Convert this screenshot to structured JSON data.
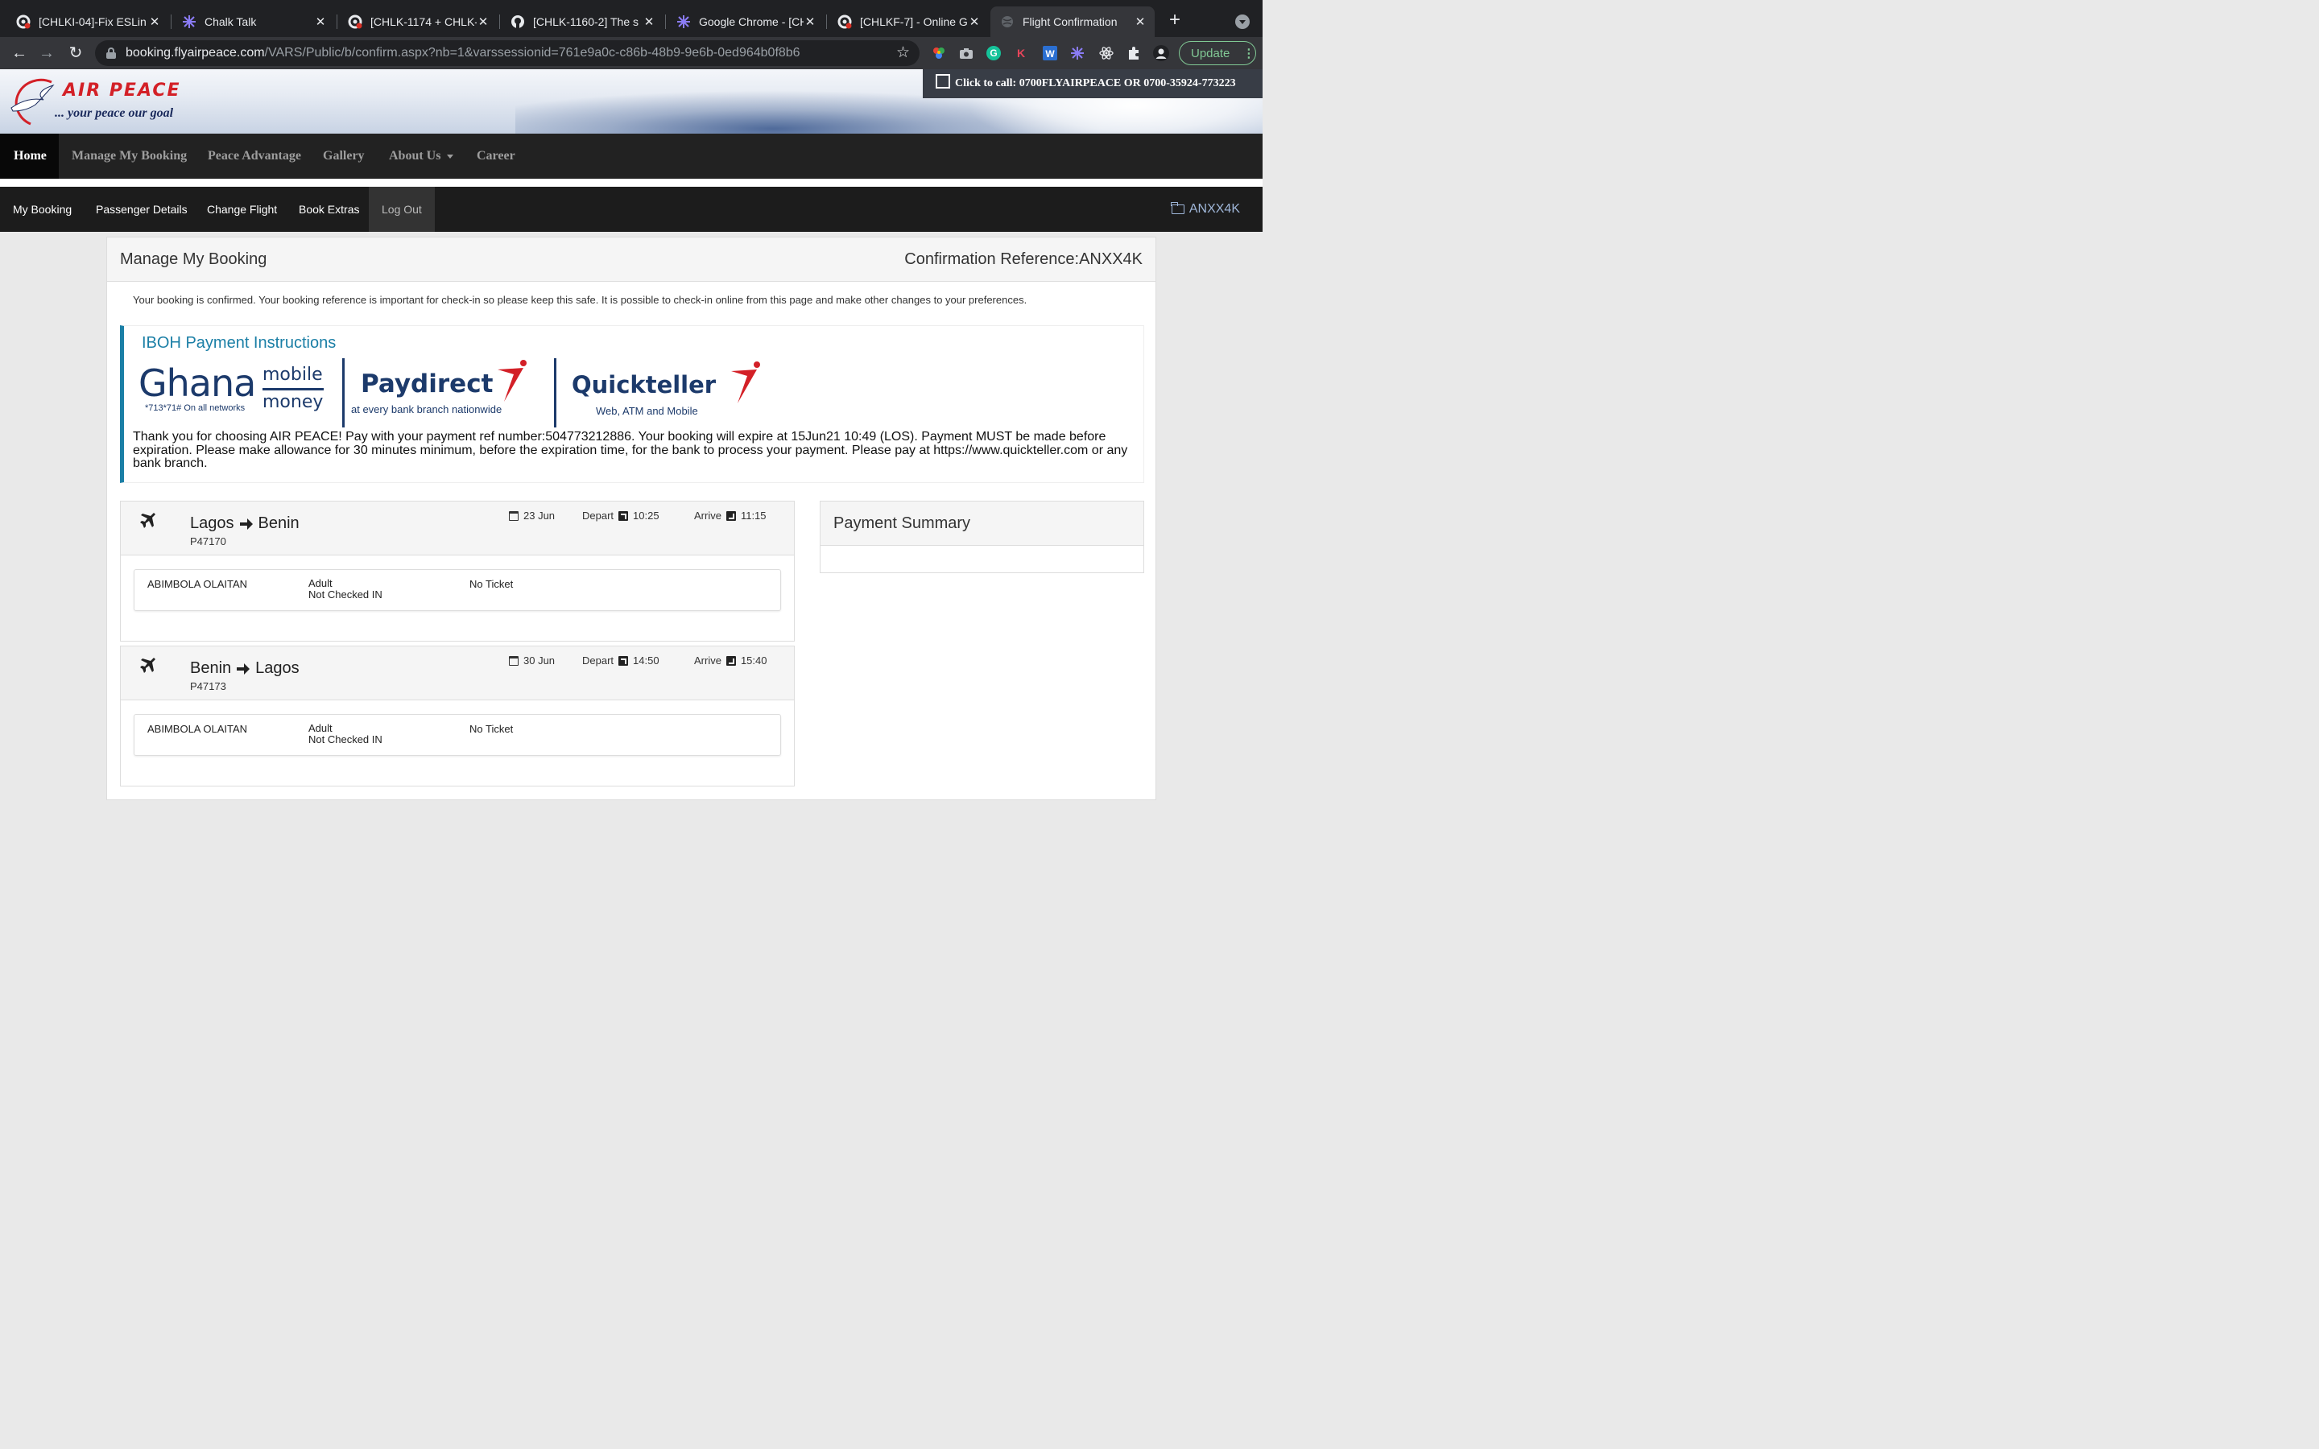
{
  "browser": {
    "tabs": [
      {
        "title": "[CHLKI-04]-Fix ESLin",
        "icon": "circleci-icon"
      },
      {
        "title": "Chalk Talk",
        "icon": "chalk-talk-icon"
      },
      {
        "title": "[CHLK-1174 + CHLK-",
        "icon": "circleci-icon"
      },
      {
        "title": "[CHLK-1160-2] The s",
        "icon": "github-icon"
      },
      {
        "title": "Google Chrome - [CH",
        "icon": "chalk-talk-icon"
      },
      {
        "title": "[CHLKF-7] - Online G",
        "icon": "circleci-icon"
      },
      {
        "title": "Flight Confirmation",
        "icon": "globe-icon"
      }
    ],
    "url_host": "booking.flyairpeace.com",
    "url_path": "/VARS/Public/b/confirm.aspx?nb=1&varssessionid=761e9a0c-c86b-48b9-9e6b-0ed964b0f8b6",
    "update_label": "Update"
  },
  "site": {
    "logo_name": "AIR PEACE",
    "tagline": "... your peace our goal",
    "call_text": "Click to call: 0700FLYAIRPEACE OR 0700-35924-773223",
    "main_nav": [
      "Home",
      "Manage My Booking",
      "Peace Advantage",
      "Gallery",
      "About Us",
      "Career"
    ],
    "sub_nav": [
      "My Booking",
      "Passenger Details",
      "Change Flight",
      "Book Extras",
      "Log Out"
    ],
    "booking_code": "ANXX4K"
  },
  "booking": {
    "title": "Manage My Booking",
    "confirmation_ref": "Confirmation Reference:ANXX4K",
    "notice": "Your booking is confirmed. Your booking reference is important for check-in so please keep this safe. It is possible to check-in online from this page and make other changes to your preferences.",
    "iboh_title": "IBOH Payment Instructions",
    "iboh_text": "Thank you for choosing AIR PEACE! Pay with your payment ref number:504773212886. Your booking will expire at 15Jun21 10:49 (LOS). Payment MUST be made before expiration. Please make allowance for 30 minutes minimum, before the expiration time, for the bank to process your payment. Please pay at https://www.quickteller.com or any bank branch.",
    "logos": {
      "ghana_word": "Ghana",
      "ghana_mobile": "mobile",
      "ghana_money": "money",
      "ghana_sub": "*713*71# On all networks",
      "paydirect": "Paydirect",
      "paydirect_sub": "at every bank branch nationwide",
      "quickteller": "Quickteller",
      "quickteller_sub": "Web, ATM and Mobile"
    },
    "flights": [
      {
        "from": "Lagos",
        "to": "Benin",
        "flight_no": "P47170",
        "date": "23 Jun",
        "depart_label": "Depart",
        "depart_time": "10:25",
        "arrive_label": "Arrive",
        "arrive_time": "11:15",
        "passenger": "ABIMBOLA OLAITAN",
        "pax_type": "Adult",
        "checkin": "Not Checked IN",
        "ticket": "No Ticket"
      },
      {
        "from": "Benin",
        "to": "Lagos",
        "flight_no": "P47173",
        "date": "30 Jun",
        "depart_label": "Depart",
        "depart_time": "14:50",
        "arrive_label": "Arrive",
        "arrive_time": "15:40",
        "passenger": "ABIMBOLA OLAITAN",
        "pax_type": "Adult",
        "checkin": "Not Checked IN",
        "ticket": "No Ticket"
      }
    ],
    "payment_summary_title": "Payment Summary"
  },
  "colors": {
    "brand_red": "#d32027",
    "brand_navy": "#1c3a6b",
    "accent_teal": "#1b7fa6",
    "update_green": "#81c995"
  }
}
